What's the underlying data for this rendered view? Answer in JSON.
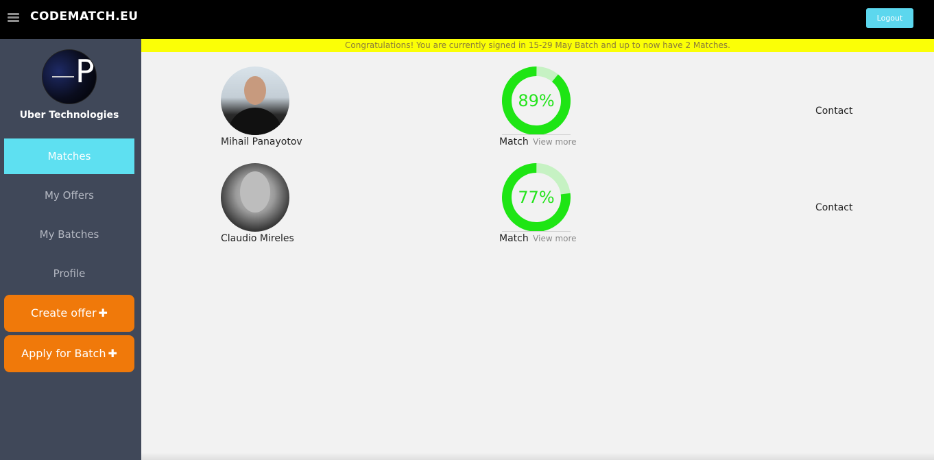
{
  "header": {
    "brand": "CODEMATCH.EU",
    "logout_label": "Logout"
  },
  "sidebar": {
    "company_name": "Uber Technologies",
    "logo_letter": "P",
    "nav": [
      {
        "label": "Matches",
        "active": true
      },
      {
        "label": "My Offers"
      },
      {
        "label": "My Batches"
      },
      {
        "label": "Profile"
      }
    ],
    "create_offer_label": "Create offer",
    "apply_batch_label": "Apply for Batch"
  },
  "banner": {
    "text": "Congratulations! You are currently signed in 15-29 May Batch and up to now have 2 Matches."
  },
  "matches": [
    {
      "name": "Mihail Panayotov",
      "percent": 89,
      "percent_label": "89%",
      "match_label": "Match",
      "view_more": "View more",
      "contact": "Contact"
    },
    {
      "name": "Claudio Mireles",
      "percent": 77,
      "percent_label": "77%",
      "match_label": "Match",
      "view_more": "View more",
      "contact": "Contact"
    }
  ],
  "colors": {
    "gauge_fill": "#1ee514",
    "gauge_track": "#c6f2c3",
    "active_nav": "#5ee0f1",
    "action_button": "#f0790a",
    "banner": "#fbff06"
  }
}
